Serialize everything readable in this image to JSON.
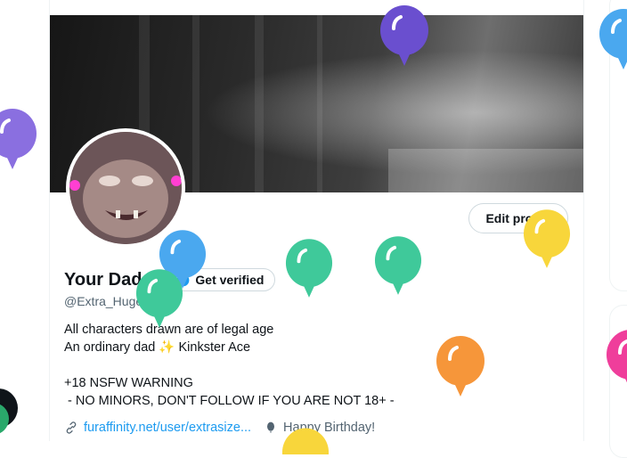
{
  "profile": {
    "display_name": "Your Dad",
    "handle": "@Extra_Huge_Bob",
    "edit_profile_label": "Edit profile",
    "get_verified_label": "Get verified",
    "bio_lines": [
      "All characters drawn are of legal age",
      "An ordinary dad ✨ Kinkster Ace",
      "",
      "+18 NSFW WARNING",
      " - NO MINORS, DON'T FOLLOW IF YOU ARE NOT 18+ -"
    ],
    "link_text": "furaffinity.net/user/extrasize...",
    "birthday_text": "Happy Birthday!"
  },
  "icons": {
    "verified": "verified-badge-icon",
    "link": "link-icon",
    "birthday": "balloon-icon"
  },
  "colors": {
    "accent": "#1d9bf0",
    "balloon_purple": "#6a4fcf",
    "balloon_blue": "#4aa8ef",
    "balloon_green": "#3fc99a",
    "balloon_yellow": "#f8d63b",
    "balloon_orange": "#f6963a",
    "balloon_pink": "#ef3e9b"
  }
}
